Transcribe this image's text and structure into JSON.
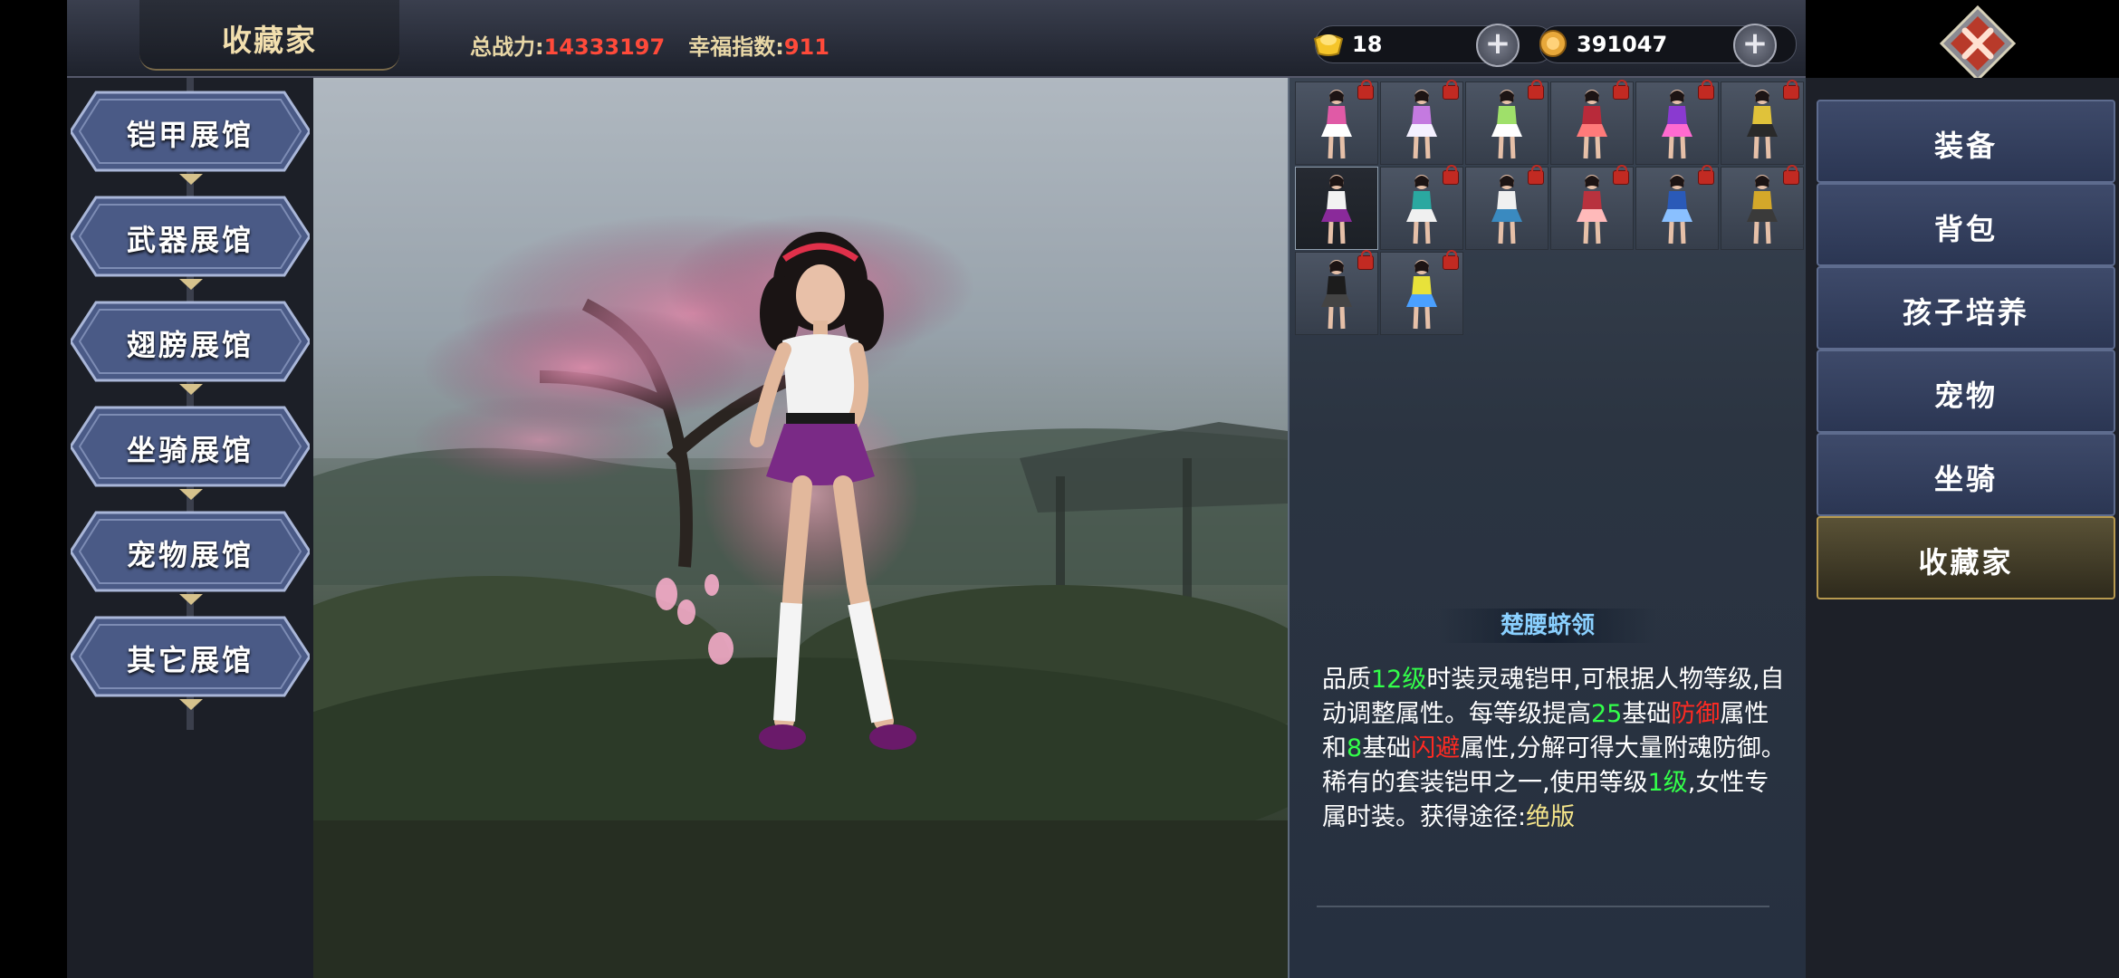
{
  "header": {
    "title": "收藏家",
    "power_label": "总战力:",
    "power_value": "14333197",
    "happiness_label": "幸福指数:",
    "happiness_value": "911",
    "gold_value": "18",
    "coin_value": "391047",
    "plus_symbol": "+"
  },
  "halls": [
    {
      "label": "铠甲展馆"
    },
    {
      "label": "武器展馆"
    },
    {
      "label": "翅膀展馆"
    },
    {
      "label": "坐骑展馆"
    },
    {
      "label": "宠物展馆"
    },
    {
      "label": "其它展馆"
    }
  ],
  "menu": [
    {
      "label": "装备"
    },
    {
      "label": "背包"
    },
    {
      "label": "孩子培养"
    },
    {
      "label": "宠物"
    },
    {
      "label": "坐骑"
    },
    {
      "label": "收藏家"
    }
  ],
  "item": {
    "name": "楚腰蛴领",
    "d1": "品质",
    "d_level": "12级",
    "d2": "时装灵魂铠甲,可根据人物等级,自动调整属性。每等级提高",
    "d_n1": "25",
    "d3": "基础",
    "d_def": "防御",
    "d4": "属性 和",
    "d_n2": "8",
    "d5": "基础",
    "d_dodge": "闪避",
    "d6": "属性,分解可得大量附魂防御。稀有的套装铠甲之一,使用等级",
    "d_req": "1级",
    "d7": ",女性专属时装。获得途径:",
    "d_source": "绝版"
  },
  "costumes": [
    {
      "colors": [
        "#e05aa6",
        "#ffffff"
      ],
      "selected": false
    },
    {
      "colors": [
        "#c47ae0",
        "#f4f0ff"
      ],
      "selected": false
    },
    {
      "colors": [
        "#9fe06a",
        "#ffffff"
      ],
      "selected": false
    },
    {
      "colors": [
        "#b82a3a",
        "#ff7a7a"
      ],
      "selected": false
    },
    {
      "colors": [
        "#8a3ad0",
        "#ff6ad0"
      ],
      "selected": false
    },
    {
      "colors": [
        "#e0c23a",
        "#2a2a2a"
      ],
      "selected": false
    },
    {
      "colors": [
        "#f2f2f2",
        "#8a2a9a"
      ],
      "selected": true
    },
    {
      "colors": [
        "#2aa8a0",
        "#f0f0f0"
      ],
      "selected": false
    },
    {
      "colors": [
        "#f0f0f0",
        "#3a8ac0"
      ],
      "selected": false
    },
    {
      "colors": [
        "#b8323e",
        "#ffbaba"
      ],
      "selected": false
    },
    {
      "colors": [
        "#2a5ab8",
        "#8ac0ff"
      ],
      "selected": false
    },
    {
      "colors": [
        "#d4a82a",
        "#3a3a3a"
      ],
      "selected": false
    },
    {
      "colors": [
        "#1c1c1c",
        "#444444"
      ],
      "selected": false
    },
    {
      "colors": [
        "#e8e23a",
        "#4aa0ff"
      ],
      "selected": false
    }
  ],
  "icons": {
    "gold": "gold-ingot-icon",
    "coin": "coin-icon",
    "close": "close-icon",
    "lock": "lock-icon"
  }
}
